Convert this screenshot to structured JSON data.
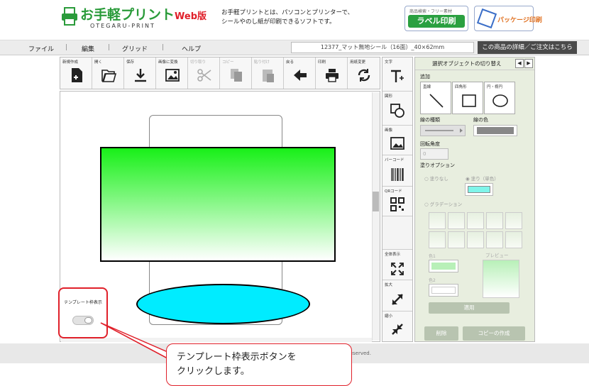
{
  "header": {
    "logo_text": "お手軽プリント",
    "logo_web": "Web版",
    "logo_sub": "OTEGARU-PRINT",
    "intro_line1": "お手軽プリントとは、パソコンとプリンターで、",
    "intro_line2": "シールやのし紙が印刷できるソフトです。",
    "label_button_top": "商品検索・フリー素材",
    "label_button": "ラベル印刷",
    "package_button": "パッケージ印刷"
  },
  "menu": {
    "items": [
      "ファイル",
      "編集",
      "グリッド",
      "ヘルプ"
    ],
    "product_name": "12377_マット無地シール（16面）_40×62mm",
    "detail_button": "この商品の詳細／ご注文はこちら"
  },
  "toolbar": {
    "tools": [
      {
        "label": "新規作成",
        "icon": "new-document-icon",
        "enabled": true
      },
      {
        "label": "開く",
        "icon": "folder-open-icon",
        "enabled": true
      },
      {
        "label": "保存",
        "icon": "download-icon",
        "enabled": true
      },
      {
        "label": "画像に変換",
        "icon": "image-icon",
        "enabled": true
      },
      {
        "label": "切り取り",
        "icon": "scissors-icon",
        "enabled": false
      },
      {
        "label": "コピー",
        "icon": "copy-icon",
        "enabled": false
      },
      {
        "label": "貼り付け",
        "icon": "paste-icon",
        "enabled": false
      },
      {
        "label": "戻る",
        "icon": "arrow-left-icon",
        "enabled": true
      },
      {
        "label": "印刷",
        "icon": "printer-icon",
        "enabled": true
      },
      {
        "label": "用紙変更",
        "icon": "refresh-icon",
        "enabled": true
      }
    ]
  },
  "sidebar": {
    "text": "文字",
    "shape": "図形",
    "image": "画像",
    "barcode": "バーコード",
    "qrcode": "QRコード",
    "fit": "全体表示",
    "zoom_in": "拡大",
    "zoom_out": "縮小"
  },
  "panel": {
    "title": "選択オブジェクトの切り替え",
    "add": "追加",
    "shape_line": "直線",
    "shape_rect": "四角形",
    "shape_circle": "円・楕円",
    "line_type": "線の種類",
    "line_color": "線の色",
    "rotation": "回転角度",
    "rotation_placeholder": "0",
    "fill_option": "塗りオプション",
    "fill_none": "塗りなし",
    "fill_solid": "塗り（単色）",
    "gradient": "グラデーション",
    "color1": "色1",
    "color2": "色2",
    "preview": "プレビュー",
    "apply": "適用",
    "delete": "削除",
    "duplicate": "コピーの作成",
    "fill_color": "#7ff5ea"
  },
  "canvas": {
    "toggle_label": "テンプレート枠表示",
    "rect_fill_top": "#18f018",
    "ellipse_fill": "#00ecff"
  },
  "footer": {
    "copyright": "reserved."
  },
  "callout": {
    "line1": "テンプレート枠表示ボタンを",
    "line2": "クリックします。"
  }
}
